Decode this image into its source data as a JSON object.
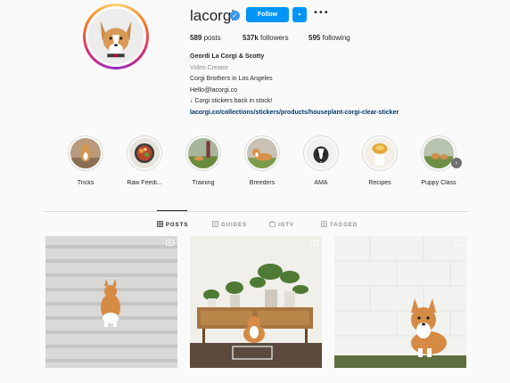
{
  "profile": {
    "username": "lacorgi",
    "follow_label": "Follow",
    "dropdown_symbol": "▾",
    "more_symbol": "•••",
    "stats": {
      "posts_count": "589",
      "posts_label": "posts",
      "followers_count": "537k",
      "followers_label": "followers",
      "following_count": "595",
      "following_label": "following"
    },
    "bio": {
      "name": "Geordi La Corgi & Scotty",
      "category": "Video Creator",
      "line1": "Corgi Brothers in Los Angeles",
      "line2": "Hello@lacorgi.co",
      "line3": "↓ Corgi stickers back in stock!",
      "link": "lacorgi.co/collections/stickers/products/houseplant-corgi-clear-sticker"
    }
  },
  "highlights": [
    {
      "label": "Tricks"
    },
    {
      "label": "Raw Feedi..."
    },
    {
      "label": "Training"
    },
    {
      "label": "Breeders"
    },
    {
      "label": "AMA"
    },
    {
      "label": "Recipes"
    },
    {
      "label": "Puppy Class"
    }
  ],
  "tabs": [
    {
      "label": "POSTS",
      "icon": "grid-icon"
    },
    {
      "label": "GUIDES",
      "icon": "guides-icon"
    },
    {
      "label": "IGTV",
      "icon": "igtv-icon"
    },
    {
      "label": "TAGGED",
      "icon": "tagged-icon"
    }
  ],
  "colors": {
    "accent": "#0095f6",
    "verified": "#3897f0",
    "link": "#00376b",
    "muted": "#8e8e8e"
  }
}
